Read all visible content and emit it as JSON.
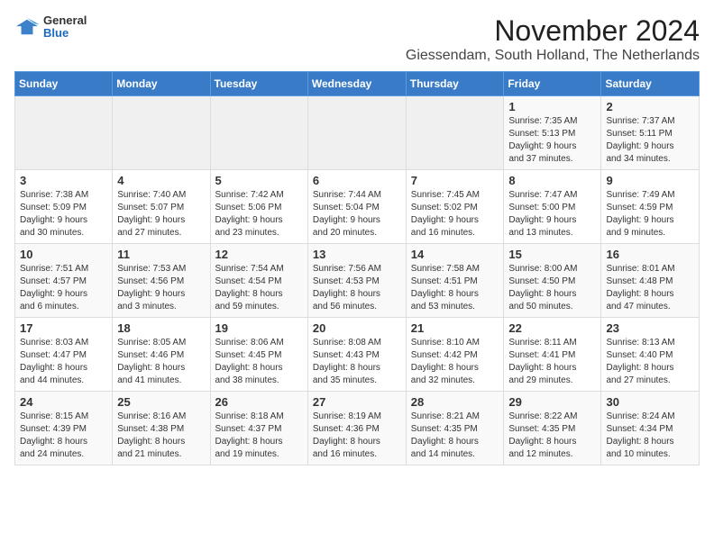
{
  "header": {
    "logo_general": "General",
    "logo_blue": "Blue",
    "month_title": "November 2024",
    "subtitle": "Giessendam, South Holland, The Netherlands"
  },
  "weekdays": [
    "Sunday",
    "Monday",
    "Tuesday",
    "Wednesday",
    "Thursday",
    "Friday",
    "Saturday"
  ],
  "weeks": [
    [
      {
        "day": "",
        "info": ""
      },
      {
        "day": "",
        "info": ""
      },
      {
        "day": "",
        "info": ""
      },
      {
        "day": "",
        "info": ""
      },
      {
        "day": "",
        "info": ""
      },
      {
        "day": "1",
        "info": "Sunrise: 7:35 AM\nSunset: 5:13 PM\nDaylight: 9 hours\nand 37 minutes."
      },
      {
        "day": "2",
        "info": "Sunrise: 7:37 AM\nSunset: 5:11 PM\nDaylight: 9 hours\nand 34 minutes."
      }
    ],
    [
      {
        "day": "3",
        "info": "Sunrise: 7:38 AM\nSunset: 5:09 PM\nDaylight: 9 hours\nand 30 minutes."
      },
      {
        "day": "4",
        "info": "Sunrise: 7:40 AM\nSunset: 5:07 PM\nDaylight: 9 hours\nand 27 minutes."
      },
      {
        "day": "5",
        "info": "Sunrise: 7:42 AM\nSunset: 5:06 PM\nDaylight: 9 hours\nand 23 minutes."
      },
      {
        "day": "6",
        "info": "Sunrise: 7:44 AM\nSunset: 5:04 PM\nDaylight: 9 hours\nand 20 minutes."
      },
      {
        "day": "7",
        "info": "Sunrise: 7:45 AM\nSunset: 5:02 PM\nDaylight: 9 hours\nand 16 minutes."
      },
      {
        "day": "8",
        "info": "Sunrise: 7:47 AM\nSunset: 5:00 PM\nDaylight: 9 hours\nand 13 minutes."
      },
      {
        "day": "9",
        "info": "Sunrise: 7:49 AM\nSunset: 4:59 PM\nDaylight: 9 hours\nand 9 minutes."
      }
    ],
    [
      {
        "day": "10",
        "info": "Sunrise: 7:51 AM\nSunset: 4:57 PM\nDaylight: 9 hours\nand 6 minutes."
      },
      {
        "day": "11",
        "info": "Sunrise: 7:53 AM\nSunset: 4:56 PM\nDaylight: 9 hours\nand 3 minutes."
      },
      {
        "day": "12",
        "info": "Sunrise: 7:54 AM\nSunset: 4:54 PM\nDaylight: 8 hours\nand 59 minutes."
      },
      {
        "day": "13",
        "info": "Sunrise: 7:56 AM\nSunset: 4:53 PM\nDaylight: 8 hours\nand 56 minutes."
      },
      {
        "day": "14",
        "info": "Sunrise: 7:58 AM\nSunset: 4:51 PM\nDaylight: 8 hours\nand 53 minutes."
      },
      {
        "day": "15",
        "info": "Sunrise: 8:00 AM\nSunset: 4:50 PM\nDaylight: 8 hours\nand 50 minutes."
      },
      {
        "day": "16",
        "info": "Sunrise: 8:01 AM\nSunset: 4:48 PM\nDaylight: 8 hours\nand 47 minutes."
      }
    ],
    [
      {
        "day": "17",
        "info": "Sunrise: 8:03 AM\nSunset: 4:47 PM\nDaylight: 8 hours\nand 44 minutes."
      },
      {
        "day": "18",
        "info": "Sunrise: 8:05 AM\nSunset: 4:46 PM\nDaylight: 8 hours\nand 41 minutes."
      },
      {
        "day": "19",
        "info": "Sunrise: 8:06 AM\nSunset: 4:45 PM\nDaylight: 8 hours\nand 38 minutes."
      },
      {
        "day": "20",
        "info": "Sunrise: 8:08 AM\nSunset: 4:43 PM\nDaylight: 8 hours\nand 35 minutes."
      },
      {
        "day": "21",
        "info": "Sunrise: 8:10 AM\nSunset: 4:42 PM\nDaylight: 8 hours\nand 32 minutes."
      },
      {
        "day": "22",
        "info": "Sunrise: 8:11 AM\nSunset: 4:41 PM\nDaylight: 8 hours\nand 29 minutes."
      },
      {
        "day": "23",
        "info": "Sunrise: 8:13 AM\nSunset: 4:40 PM\nDaylight: 8 hours\nand 27 minutes."
      }
    ],
    [
      {
        "day": "24",
        "info": "Sunrise: 8:15 AM\nSunset: 4:39 PM\nDaylight: 8 hours\nand 24 minutes."
      },
      {
        "day": "25",
        "info": "Sunrise: 8:16 AM\nSunset: 4:38 PM\nDaylight: 8 hours\nand 21 minutes."
      },
      {
        "day": "26",
        "info": "Sunrise: 8:18 AM\nSunset: 4:37 PM\nDaylight: 8 hours\nand 19 minutes."
      },
      {
        "day": "27",
        "info": "Sunrise: 8:19 AM\nSunset: 4:36 PM\nDaylight: 8 hours\nand 16 minutes."
      },
      {
        "day": "28",
        "info": "Sunrise: 8:21 AM\nSunset: 4:35 PM\nDaylight: 8 hours\nand 14 minutes."
      },
      {
        "day": "29",
        "info": "Sunrise: 8:22 AM\nSunset: 4:35 PM\nDaylight: 8 hours\nand 12 minutes."
      },
      {
        "day": "30",
        "info": "Sunrise: 8:24 AM\nSunset: 4:34 PM\nDaylight: 8 hours\nand 10 minutes."
      }
    ]
  ]
}
